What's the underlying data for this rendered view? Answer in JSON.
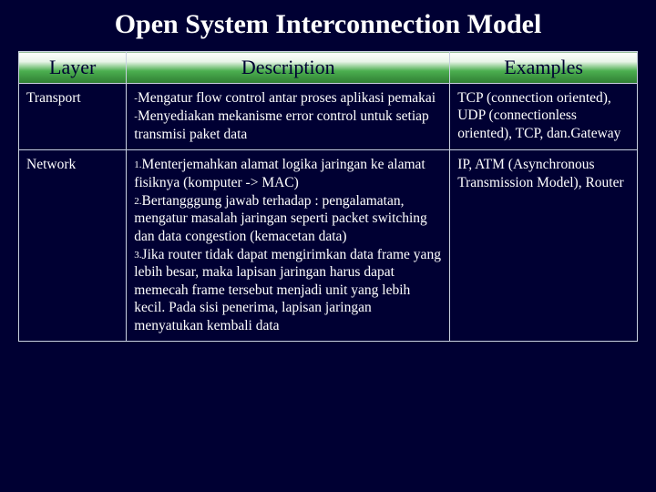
{
  "title": "Open System Interconnection Model",
  "headers": {
    "layer": "Layer",
    "description": "Description",
    "examples": "Examples"
  },
  "rows": [
    {
      "layer": "Transport",
      "desc1": "Mengatur flow control antar proses aplikasi pemakai",
      "desc2": "Menyediakan mekanisme error control untuk setiap transmisi paket data",
      "examples": "TCP (connection  oriented), UDP (connectionless oriented), TCP, dan.Gateway"
    },
    {
      "layer": "Network",
      "num1": "1.",
      "desc1": "Menterjemahkan alamat logika jaringan ke alamat fisiknya (komputer -> MAC)",
      "num2": "2.",
      "desc2": "Bertangggung jawab terhadap : pengalamatan, mengatur masalah jaringan seperti packet switching dan data congestion (kemacetan data)",
      "num3": "3.",
      "desc3": "Jika router tidak dapat mengirimkan data frame yang lebih besar, maka lapisan jaringan harus dapat memecah frame tersebut menjadi unit yang lebih kecil. Pada sisi penerima, lapisan jaringan menyatukan kembali data",
      "examples": "IP, ATM (Asynchronous Transmission Model), Router"
    }
  ]
}
